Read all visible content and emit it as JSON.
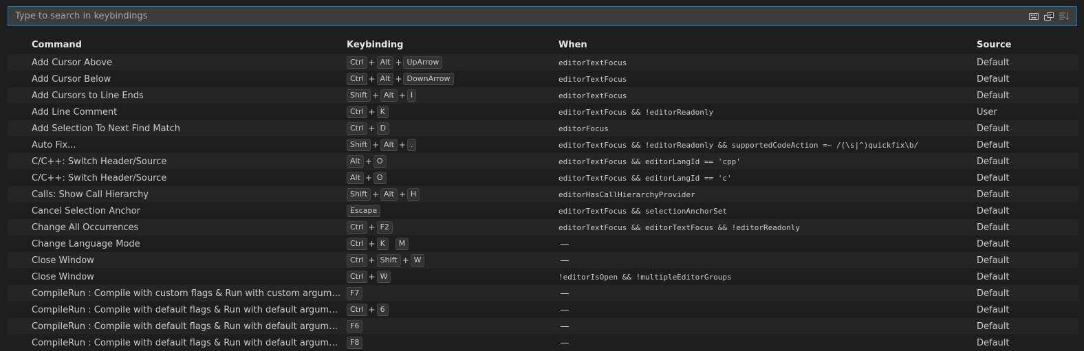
{
  "search": {
    "placeholder": "Type to search in keybindings",
    "actions": [
      {
        "name": "keyboard-icon"
      },
      {
        "name": "record-keys-icon"
      },
      {
        "name": "sort-by-precedence-icon"
      }
    ]
  },
  "columns": {
    "command": "Command",
    "keybinding": "Keybinding",
    "when": "When",
    "source": "Source"
  },
  "rows": [
    {
      "command": "Add Cursor Above",
      "keys": [
        [
          "Ctrl",
          "Alt",
          "UpArrow"
        ]
      ],
      "when": "editorTextFocus",
      "source": "Default"
    },
    {
      "command": "Add Cursor Below",
      "keys": [
        [
          "Ctrl",
          "Alt",
          "DownArrow"
        ]
      ],
      "when": "editorTextFocus",
      "source": "Default"
    },
    {
      "command": "Add Cursors to Line Ends",
      "keys": [
        [
          "Shift",
          "Alt",
          "I"
        ]
      ],
      "when": "editorTextFocus",
      "source": "Default"
    },
    {
      "command": "Add Line Comment",
      "keys": [
        [
          "Ctrl",
          "K"
        ]
      ],
      "when": "editorTextFocus && !editorReadonly",
      "source": "User"
    },
    {
      "command": "Add Selection To Next Find Match",
      "keys": [
        [
          "Ctrl",
          "D"
        ]
      ],
      "when": "editorFocus",
      "source": "Default"
    },
    {
      "command": "Auto Fix...",
      "keys": [
        [
          "Shift",
          "Alt",
          "."
        ]
      ],
      "when": "editorTextFocus && !editorReadonly && supportedCodeAction =~ /(\\s|^)quickfix\\b/",
      "source": "Default"
    },
    {
      "command": "C/C++: Switch Header/Source",
      "keys": [
        [
          "Alt",
          "O"
        ]
      ],
      "when": "editorTextFocus && editorLangId == 'cpp'",
      "source": "Default"
    },
    {
      "command": "C/C++: Switch Header/Source",
      "keys": [
        [
          "Alt",
          "O"
        ]
      ],
      "when": "editorTextFocus && editorLangId == 'c'",
      "source": "Default"
    },
    {
      "command": "Calls: Show Call Hierarchy",
      "keys": [
        [
          "Shift",
          "Alt",
          "H"
        ]
      ],
      "when": "editorHasCallHierarchyProvider",
      "source": "Default"
    },
    {
      "command": "Cancel Selection Anchor",
      "keys": [
        [
          "Escape"
        ]
      ],
      "when": "editorTextFocus && selectionAnchorSet",
      "source": "Default"
    },
    {
      "command": "Change All Occurrences",
      "keys": [
        [
          "Ctrl",
          "F2"
        ]
      ],
      "when": "editorTextFocus && editorTextFocus && !editorReadonly",
      "source": "Default"
    },
    {
      "command": "Change Language Mode",
      "keys": [
        [
          "Ctrl",
          "K"
        ],
        [
          "M"
        ]
      ],
      "when": "",
      "source": "Default"
    },
    {
      "command": "Close Window",
      "keys": [
        [
          "Ctrl",
          "Shift",
          "W"
        ]
      ],
      "when": "",
      "source": "Default"
    },
    {
      "command": "Close Window",
      "keys": [
        [
          "Ctrl",
          "W"
        ]
      ],
      "when": "!editorIsOpen && !multipleEditorGroups",
      "source": "Default"
    },
    {
      "command": "CompileRun : Compile with custom flags & Run with custom arguments",
      "keys": [
        [
          "F7"
        ]
      ],
      "when": "",
      "source": "Default"
    },
    {
      "command": "CompileRun : Compile with default flags & Run with default arguments",
      "keys": [
        [
          "Ctrl",
          "6"
        ]
      ],
      "when": "",
      "source": "Default"
    },
    {
      "command": "CompileRun : Compile with default flags & Run with default arguments",
      "keys": [
        [
          "F6"
        ]
      ],
      "when": "",
      "source": "Default"
    },
    {
      "command": "CompileRun : Compile with default flags & Run with default arguments in ext...",
      "keys": [
        [
          "F8"
        ]
      ],
      "when": "",
      "source": "Default"
    }
  ]
}
